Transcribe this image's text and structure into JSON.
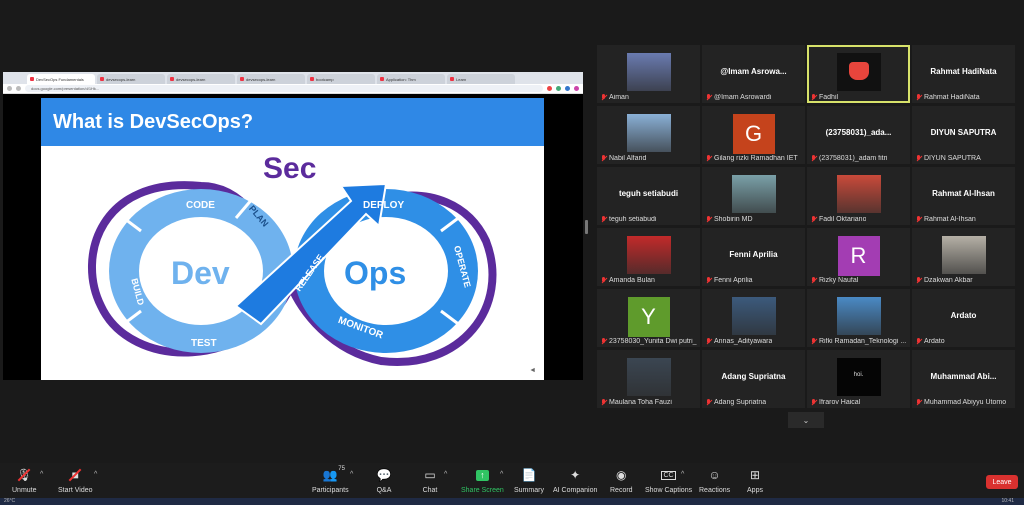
{
  "browser": {
    "tabs": [
      "DevSecOps Fundamentals",
      "devsecops-learn",
      "devsecops-learn",
      "devsecops-learn",
      "bootcamp",
      "Application: Thm",
      "Learn"
    ],
    "address": "docs.google.com/presentation/d/1Hk..."
  },
  "slide": {
    "title": "What is DevSecOps?",
    "sec": "Sec",
    "dev": "Dev",
    "ops": "Ops",
    "stages": {
      "code": "CODE",
      "plan": "PLAN",
      "build": "BUILD",
      "test": "TEST",
      "release": "RELEASE",
      "deploy": "DEPLOY",
      "operate": "OPERATE",
      "monitor": "MONITOR"
    }
  },
  "participants": [
    {
      "name": "Aiman",
      "type": "photo",
      "color": "#6a7bb0"
    },
    {
      "name": "@Imam Asrowardi",
      "type": "name",
      "display": "@Imam Asrowa..."
    },
    {
      "name": "Fadhil",
      "type": "logo",
      "speaking": true
    },
    {
      "name": "Rahmat HadiNata",
      "type": "name",
      "display": "Rahmat HadiNata"
    },
    {
      "name": "Nabil Alfarid",
      "type": "photo",
      "color": "#8ab0d6"
    },
    {
      "name": "Gilang rizki Ramadhan IET",
      "type": "letter",
      "letter": "G",
      "color": "#c5431c"
    },
    {
      "name": "(23758031)_adam fitri",
      "type": "name",
      "display": "(23758031)_ada..."
    },
    {
      "name": "DIYUN SAPUTRA",
      "type": "name",
      "display": "DIYUN SAPUTRA"
    },
    {
      "name": "teguh setiabudi",
      "type": "name",
      "display": "teguh setiabudi"
    },
    {
      "name": "Shobirin MD",
      "type": "photo",
      "color": "#7aa0a8"
    },
    {
      "name": "Fadil Oktariano",
      "type": "photo",
      "color": "#c94a3a"
    },
    {
      "name": "Rahmat Al-Ihsan",
      "type": "name",
      "display": "Rahmat Al-Ihsan"
    },
    {
      "name": "Amanda Bulan",
      "type": "photo",
      "color": "#c22a2a"
    },
    {
      "name": "Fenni Aprilia",
      "type": "name",
      "display": "Fenni Aprilia"
    },
    {
      "name": "Rizky Naufal",
      "type": "letter",
      "letter": "R",
      "color": "#a33db3"
    },
    {
      "name": "Dzakwan Akbar",
      "type": "photo",
      "color": "#b5b0a6"
    },
    {
      "name": "23758030_Yunita Dwi putri_...",
      "type": "letter",
      "letter": "Y",
      "color": "#5f9b2c"
    },
    {
      "name": "Annas_Adityawara",
      "type": "photo",
      "color": "#3c5a7c"
    },
    {
      "name": "Rifki Ramadan_Teknologi ...",
      "type": "photo",
      "color": "#4a8ac5"
    },
    {
      "name": "Ardato",
      "type": "name",
      "display": "Ardato"
    },
    {
      "name": "Maulana Toha Fauzi",
      "type": "photo",
      "color": "#3b4652"
    },
    {
      "name": "Adang Supriatna",
      "type": "name",
      "display": "Adang Supriatna"
    },
    {
      "name": "Ifrarov Haical",
      "type": "dark",
      "display": "hoi."
    },
    {
      "name": "Muhammad Abiyyu Utomo",
      "type": "name",
      "display": "Muhammad Abi..."
    }
  ],
  "toolbar": {
    "unmute": "Unmute",
    "start_video": "Start Video",
    "participants": "Participants",
    "participants_count": "75",
    "qa": "Q&A",
    "chat": "Chat",
    "share_screen": "Share Screen",
    "summary": "Summary",
    "ai_companion": "AI Companion",
    "record": "Record",
    "show_captions": "Show Captions",
    "reactions": "Reactions",
    "apps": "Apps",
    "leave": "Leave"
  },
  "taskbar": {
    "temp": "26°C",
    "clock": "10:41"
  },
  "colors": {
    "accent_green": "#30c463",
    "leave_red": "#d9312f",
    "slide_blue": "#2f88e6",
    "sec_purple": "#5b2b9c"
  }
}
